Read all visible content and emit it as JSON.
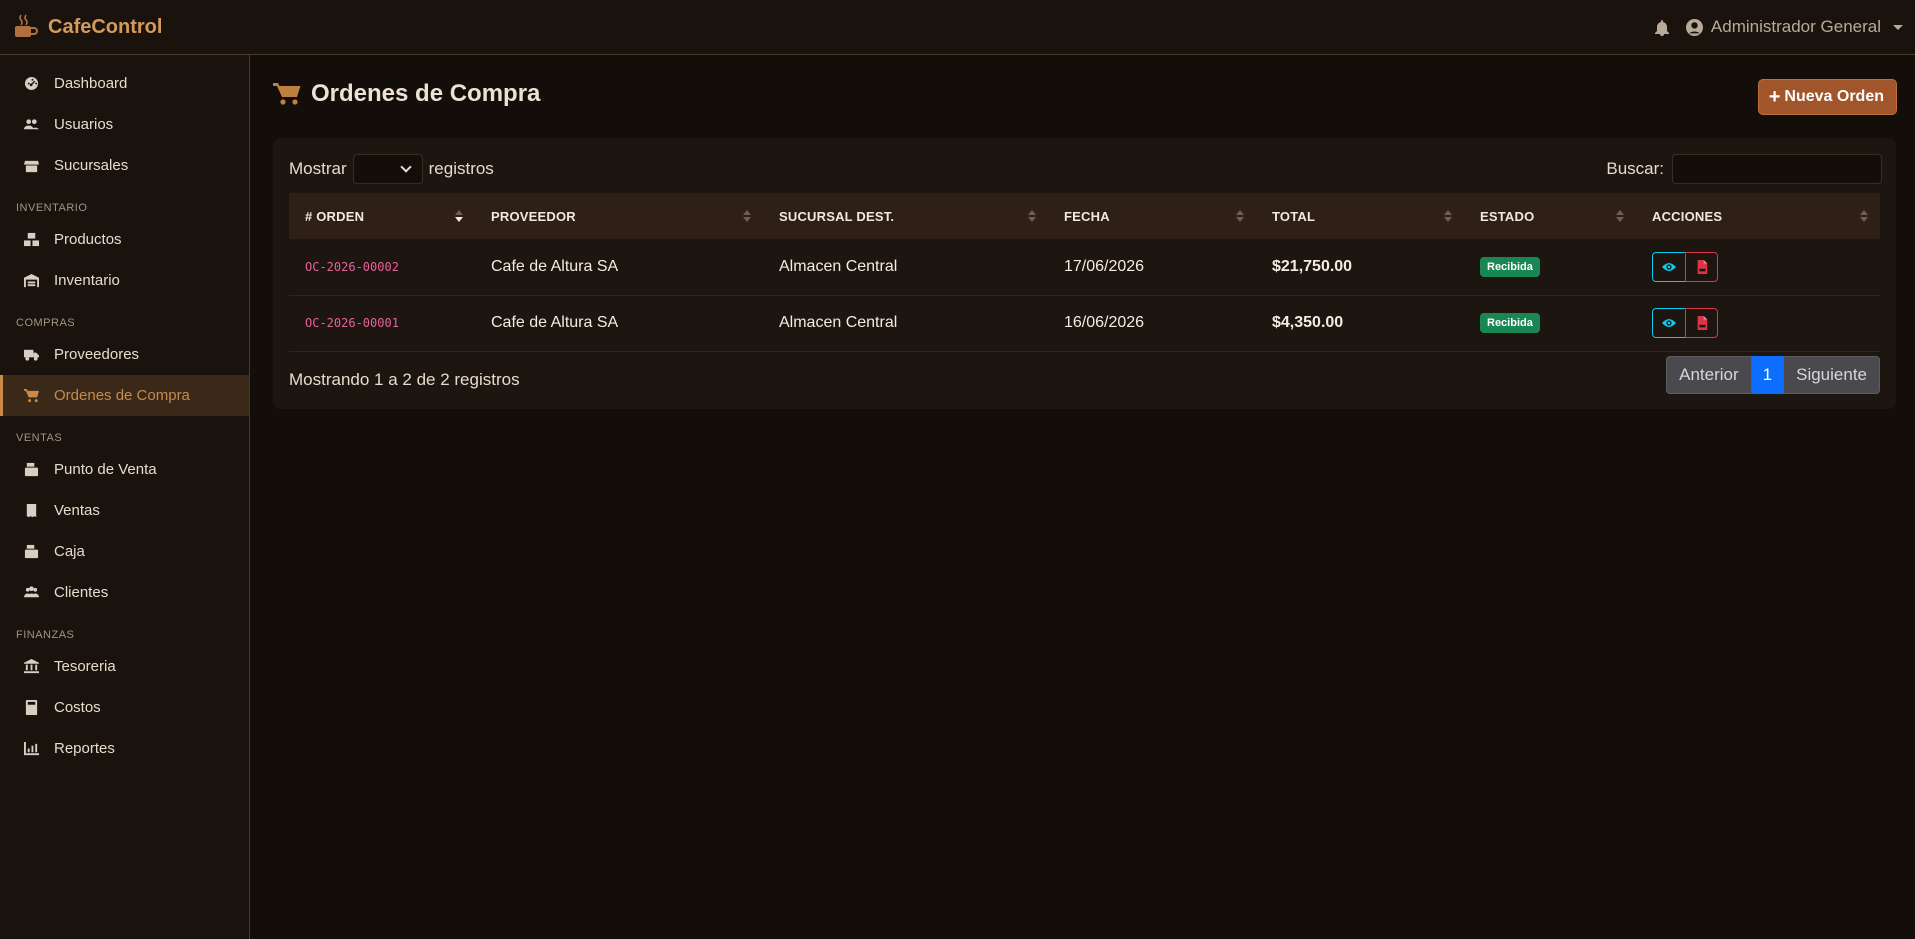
{
  "brand": {
    "name": "CafeControl",
    "icon": "coffee-mug-icon",
    "color": "#d49a5a"
  },
  "navbar": {
    "user": "Administrador General"
  },
  "sidebar": {
    "items": [
      {
        "label": "Dashboard",
        "icon": "dashboard-icon"
      },
      {
        "label": "Usuarios",
        "icon": "users-icon"
      },
      {
        "label": "Sucursales",
        "icon": "store-icon"
      }
    ],
    "sections": [
      {
        "title": "INVENTARIO",
        "items": [
          {
            "label": "Productos"
          },
          {
            "label": "Inventario"
          }
        ]
      },
      {
        "title": "COMPRAS",
        "items": [
          {
            "label": "Proveedores"
          },
          {
            "label": "Ordenes de Compra",
            "active": true
          }
        ]
      },
      {
        "title": "VENTAS",
        "items": [
          {
            "label": "Punto de Venta"
          },
          {
            "label": "Ventas"
          },
          {
            "label": "Caja"
          },
          {
            "label": "Clientes"
          }
        ]
      },
      {
        "title": "FINANZAS",
        "items": [
          {
            "label": "Tesoreria"
          },
          {
            "label": "Costos"
          },
          {
            "label": "Reportes"
          }
        ]
      }
    ]
  },
  "page": {
    "title": "Ordenes de Compra",
    "new_button": "Nueva Orden"
  },
  "table_controls": {
    "show_label": "Mostrar",
    "records_label": "registros",
    "search_label": "Buscar:"
  },
  "table": {
    "columns": [
      "# ORDEN",
      "PROVEEDOR",
      "SUCURSAL DEST.",
      "FECHA",
      "TOTAL",
      "ESTADO",
      "ACCIONES"
    ],
    "rows": [
      {
        "order": "OC-2026-00002",
        "provider": "Cafe de Altura SA",
        "branch": "Almacen Central",
        "date": "17/06/2026",
        "total": "$21,750.00",
        "status": "Recibida"
      },
      {
        "order": "OC-2026-00001",
        "provider": "Cafe de Altura SA",
        "branch": "Almacen Central",
        "date": "16/06/2026",
        "total": "$4,350.00",
        "status": "Recibida"
      }
    ]
  },
  "footer": {
    "info": "Mostrando 1 a 2 de 2 registros",
    "prev": "Anterior",
    "current_page": "1",
    "next": "Siguiente"
  },
  "colors": {
    "accent": "#c98a4a",
    "success": "#198754",
    "info": "#0dcaf0",
    "danger": "#dc3545",
    "primary": "#0d6efd"
  }
}
